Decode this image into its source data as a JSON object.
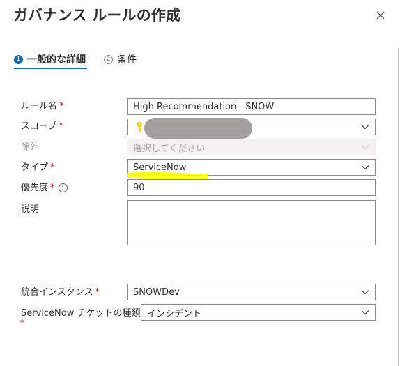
{
  "panel": {
    "title": "ガバナンス ルールの作成",
    "close_icon": "close-icon"
  },
  "tabs": [
    {
      "step": "1",
      "label": "一般的な詳細",
      "active": true
    },
    {
      "step": "2",
      "label": "条件",
      "active": false
    }
  ],
  "form": {
    "rule_name": {
      "label": "ルール名",
      "required": "*",
      "value": "High Recommendation - SNOW"
    },
    "scope": {
      "label": "スコープ",
      "required": "*",
      "value": ""
    },
    "exclude": {
      "label": "除外",
      "placeholder": "選択してください"
    },
    "type": {
      "label": "タイプ",
      "required": "*",
      "value": "ServiceNow"
    },
    "priority": {
      "label": "優先度",
      "required": "*",
      "info": "i",
      "value": "90"
    },
    "description": {
      "label": "説明",
      "value": ""
    },
    "integration_instance": {
      "label": "統合インスタンス",
      "required": "*",
      "value": "SNOWDev"
    },
    "ticket_type": {
      "label": "ServiceNow チケットの種類",
      "required": "*",
      "value": "インシデント"
    }
  },
  "colors": {
    "accent": "#0f6cbd",
    "required": "#a4262c",
    "highlight": "#ffff00",
    "key": "#f2c811",
    "redaction": "#a19f9d"
  }
}
